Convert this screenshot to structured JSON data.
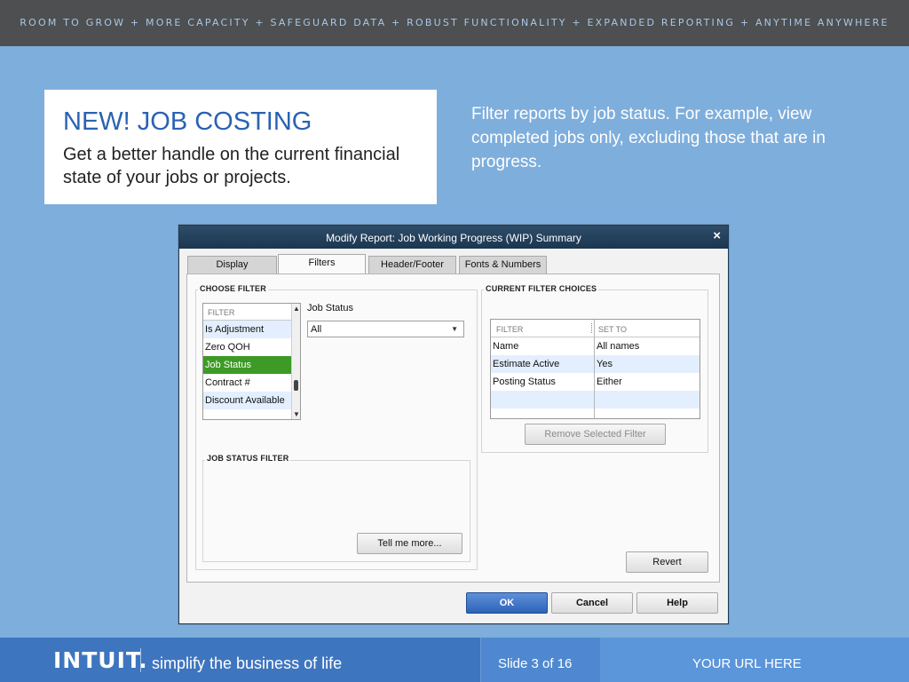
{
  "topbar": {
    "text": "ROOM TO GROW + MORE CAPACITY + SAFEGUARD DATA + ROBUST FUNCTIONALITY + EXPANDED REPORTING + ANYTIME ANYWHERE"
  },
  "callout": {
    "title": "NEW! JOB COSTING",
    "subtitle": "Get a better handle on the current financial state of your jobs or projects."
  },
  "description": "Filter reports by job status. For example, view completed jobs only, excluding those that are in progress.",
  "dialog": {
    "title": "Modify Report: Job Working Progress (WIP) Summary",
    "close_icon": "×",
    "tabs": [
      {
        "label": "Display"
      },
      {
        "label": "Filters"
      },
      {
        "label": "Header/Footer"
      },
      {
        "label": "Fonts & Numbers"
      }
    ],
    "choose_filter": {
      "group_label": "CHOOSE FILTER",
      "list_header": "FILTER",
      "items": [
        "Is Adjustment",
        "Zero QOH",
        "Job Status",
        "Contract #",
        "Discount Available"
      ],
      "selected": "Job Status",
      "field_label": "Job Status",
      "dropdown_value": "All"
    },
    "job_status_filter": {
      "group_label": "JOB STATUS FILTER",
      "tell_me_more": "Tell me more..."
    },
    "current_filters": {
      "group_label": "CURRENT FILTER CHOICES",
      "col_filter": "FILTER",
      "col_set_to": "SET TO",
      "rows": [
        {
          "filter": "Name",
          "set_to": "All names"
        },
        {
          "filter": "Estimate Active",
          "set_to": "Yes"
        },
        {
          "filter": "Posting Status",
          "set_to": "Either"
        }
      ],
      "remove_button": "Remove Selected Filter"
    },
    "revert_button": "Revert",
    "ok_button": "OK",
    "cancel_button": "Cancel",
    "help_button": "Help"
  },
  "footer": {
    "logo": "INTUIT.",
    "tagline": "simplify the business of life",
    "slide": "Slide 3 of 16",
    "url": "YOUR URL HERE"
  },
  "colors": {
    "background": "#7eaedc",
    "topbar": "#4d4f51",
    "title_blue": "#2a62b3",
    "selected_green": "#3d9a25",
    "footer_blue": "#3b73bd"
  }
}
